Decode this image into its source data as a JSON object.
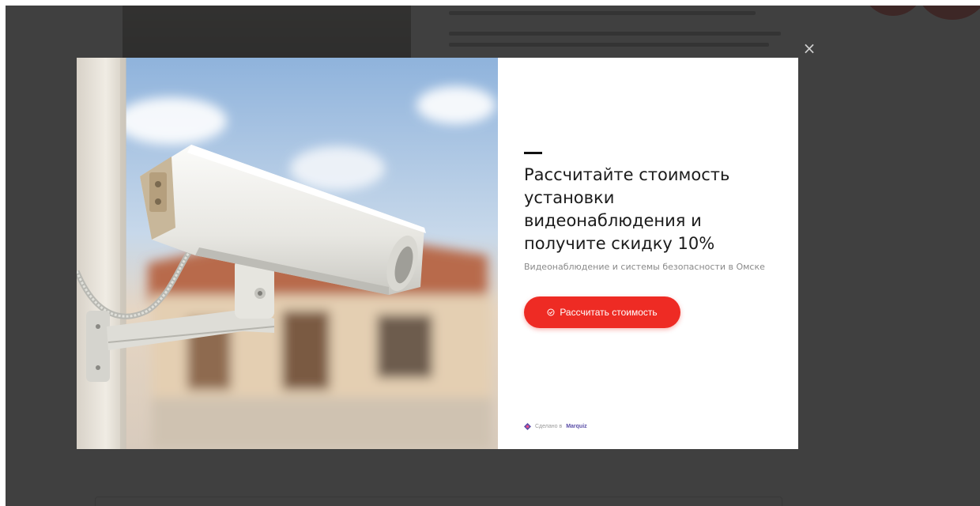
{
  "modal": {
    "close_label": "×",
    "headline": "Рассчитайте стоимость установки видеонаблюдения и получите скидку 10%",
    "subtitle": "Видеонаблюдение и системы безопасности в Омске",
    "cta_label": "Рассчитать стоимость",
    "footer_prefix": "Сделано в",
    "footer_brand": "Marquiz"
  },
  "colors": {
    "accent": "#ee2b24",
    "overlay": "#252525",
    "brand": "#5b4fa8"
  },
  "icons": {
    "close": "close-icon",
    "cta": "check-circle-icon",
    "footer": "marquiz-logo-icon"
  }
}
